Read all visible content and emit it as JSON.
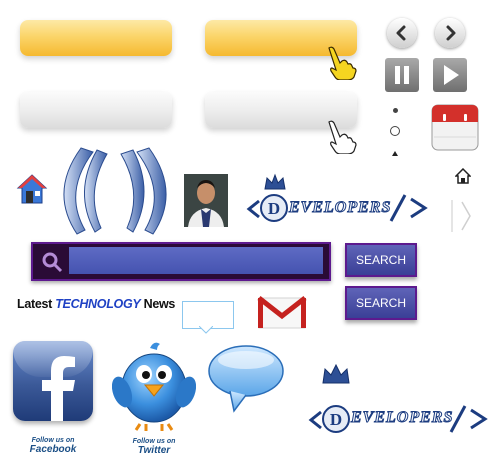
{
  "logo": {
    "text": "EVELOPERS"
  },
  "search": {
    "button_label": "SEARCH",
    "button_label_2": "SEARCH"
  },
  "headline": {
    "latest": "Latest",
    "technology": "TECHNOLOGY",
    "news": "News"
  },
  "facebook": {
    "follow": "Follow us on",
    "name": "Facebook"
  },
  "twitter": {
    "follow": "Follow us on",
    "name": "Twitter"
  },
  "icons": [
    "cursor-hand-icon",
    "chevron-left-icon",
    "chevron-right-icon",
    "pause-icon",
    "play-icon",
    "calendar-icon",
    "home-icon",
    "email-icon",
    "facebook-icon",
    "twitter-bird-icon",
    "speech-bubble-icon",
    "crown-icon"
  ],
  "colors": {
    "yellow": "#f5b930",
    "purple": "#5d1a8e",
    "blue": "#3a3f96",
    "facebook": "#3b5998",
    "gmail_red": "#c5221f"
  }
}
